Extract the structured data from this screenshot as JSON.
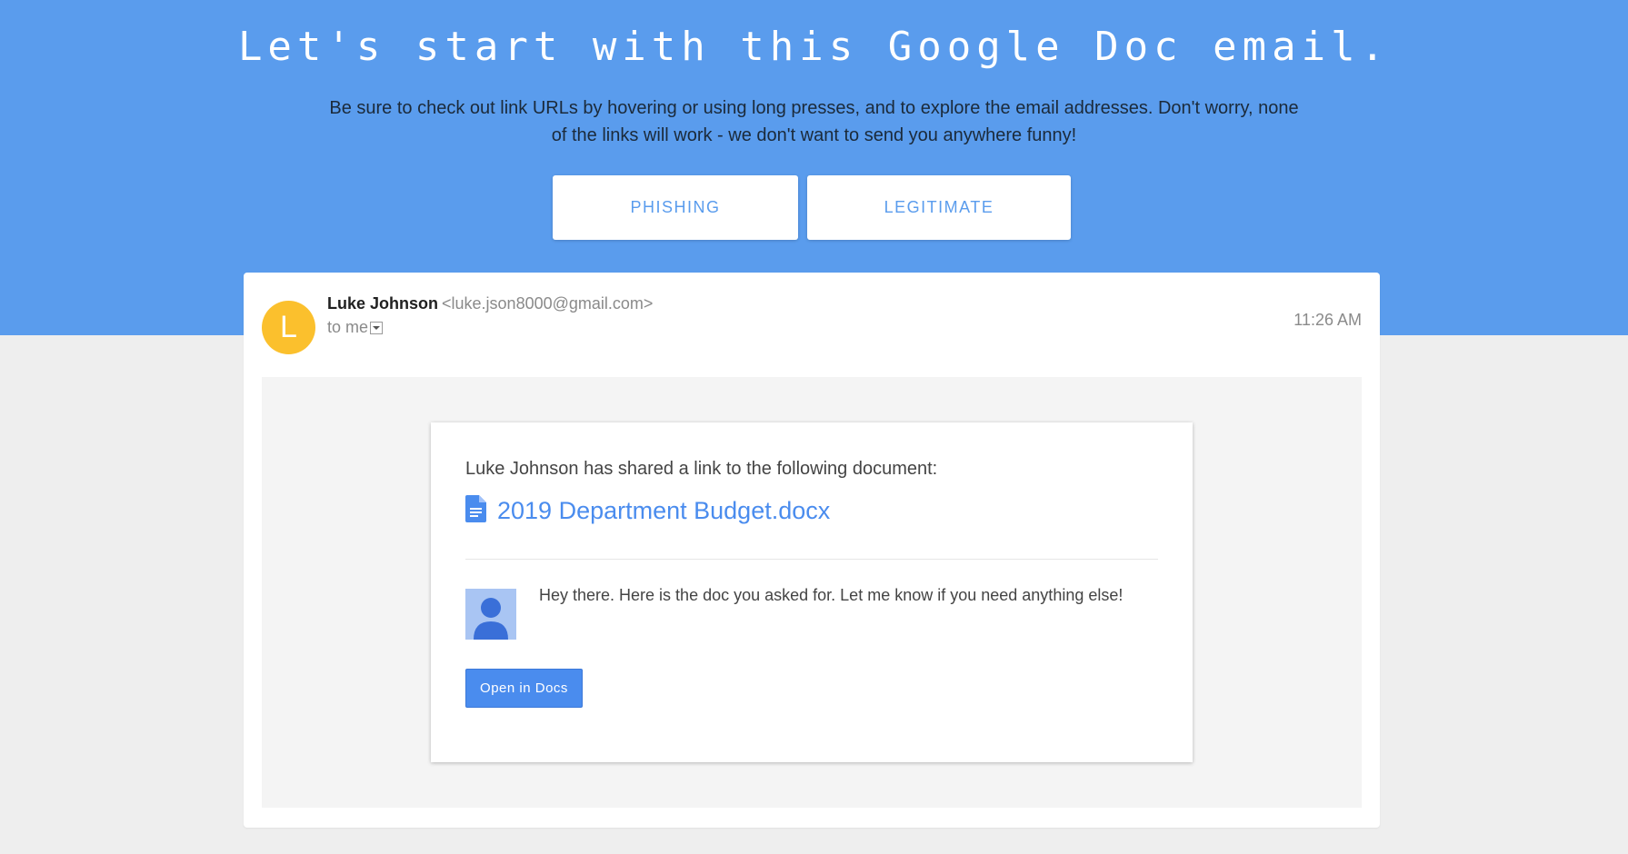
{
  "hero": {
    "title": "Let's start with this Google Doc email.",
    "description": "Be sure to check out link URLs by hovering or using long presses, and to explore the email addresses. Don't worry, none of the links will work - we don't want to send you anywhere funny!",
    "phishing_label": "PHISHING",
    "legitimate_label": "LEGITIMATE"
  },
  "email": {
    "avatar_letter": "L",
    "sender_name": "Luke Johnson",
    "sender_email": "<luke.json8000@gmail.com>",
    "to_label": "to me",
    "time": "11:26 AM",
    "body": {
      "intro": "Luke Johnson has shared a link to the following document:",
      "document_title": "2019 Department Budget.docx",
      "message": "Hey there. Here is the doc you asked for. Let me know if you need anything else!",
      "open_button_label": "Open in Docs"
    }
  },
  "colors": {
    "hero_bg": "#5a9ced",
    "page_bg": "#eeeeee",
    "avatar_bg": "#fbc02d",
    "link_blue": "#4a8cee"
  },
  "icons": {
    "document": "google-doc-icon",
    "profile": "profile-placeholder-icon",
    "caret": "chevron-down-icon"
  }
}
